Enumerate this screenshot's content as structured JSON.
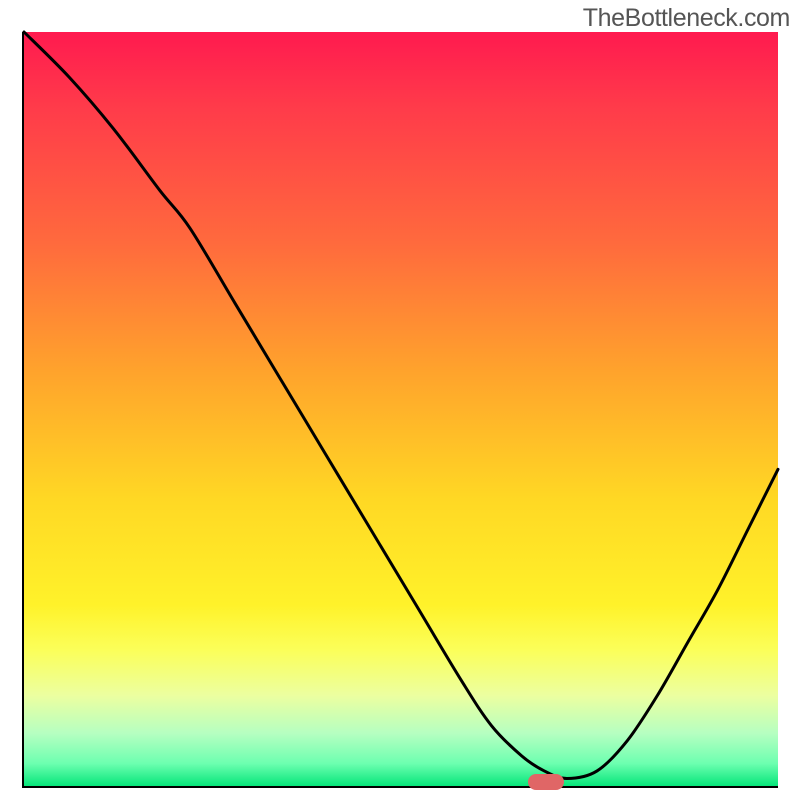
{
  "watermark": "TheBottleneck.com",
  "chart_data": {
    "type": "line",
    "title": "",
    "xlabel": "",
    "ylabel": "",
    "xlim": [
      0,
      100
    ],
    "ylim": [
      0,
      100
    ],
    "grid": false,
    "legend": false,
    "series": [
      {
        "name": "curve",
        "x": [
          0,
          6,
          12,
          18,
          22,
          28,
          34,
          40,
          46,
          52,
          58,
          62,
          66,
          69,
          72,
          76,
          80,
          84,
          88,
          92,
          96,
          100
        ],
        "y": [
          100,
          94,
          87,
          79,
          74,
          64,
          54,
          44,
          34,
          24,
          14,
          8,
          4,
          2,
          1,
          2,
          6,
          12,
          19,
          26,
          34,
          42
        ]
      }
    ],
    "marker": {
      "x": 69,
      "y": 0.8,
      "color": "#e06666"
    },
    "gradient_stops": [
      {
        "pct": 0,
        "color": "#ff1a4f"
      },
      {
        "pct": 45,
        "color": "#ffa32c"
      },
      {
        "pct": 76,
        "color": "#fff22a"
      },
      {
        "pct": 100,
        "color": "#07e67a"
      }
    ]
  }
}
